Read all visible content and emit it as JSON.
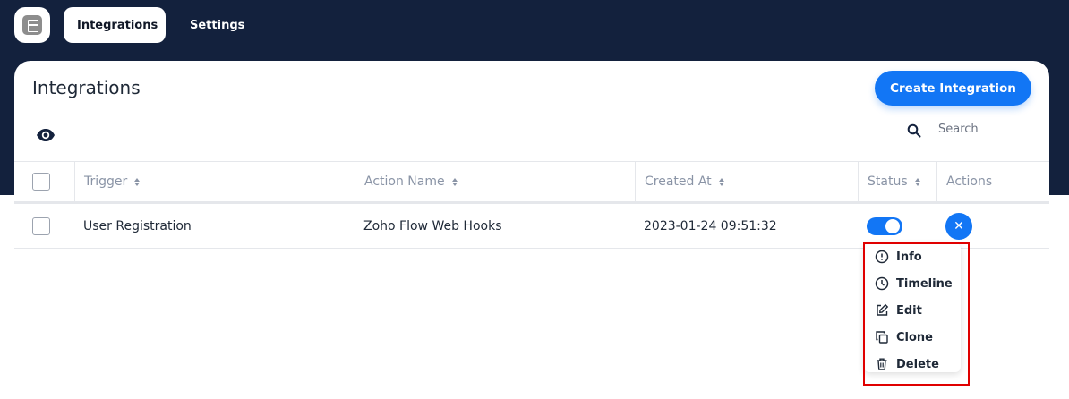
{
  "nav": {
    "tabs": [
      {
        "label": "Integrations"
      },
      {
        "label": "Settings"
      }
    ]
  },
  "panel": {
    "title": "Integrations",
    "create_button": "Create Integration",
    "search": {
      "placeholder": "Search",
      "value": ""
    }
  },
  "table": {
    "headers": [
      "Trigger",
      "Action Name",
      "Created At",
      "Status",
      "Actions"
    ],
    "rows": [
      {
        "trigger": "User Registration",
        "action_name": "Zoho Flow Web Hooks",
        "created_at": "2023-01-24 09:51:32",
        "status_on": true
      }
    ]
  },
  "actions_menu": {
    "items": [
      {
        "label": "Info",
        "icon": "info-icon"
      },
      {
        "label": "Timeline",
        "icon": "clock-icon"
      },
      {
        "label": "Edit",
        "icon": "edit-icon"
      },
      {
        "label": "Clone",
        "icon": "clone-icon"
      },
      {
        "label": "Delete",
        "icon": "trash-icon"
      }
    ]
  },
  "colors": {
    "topbar": "#13213d",
    "accent": "#1276f5",
    "highlight": "#e00000"
  }
}
